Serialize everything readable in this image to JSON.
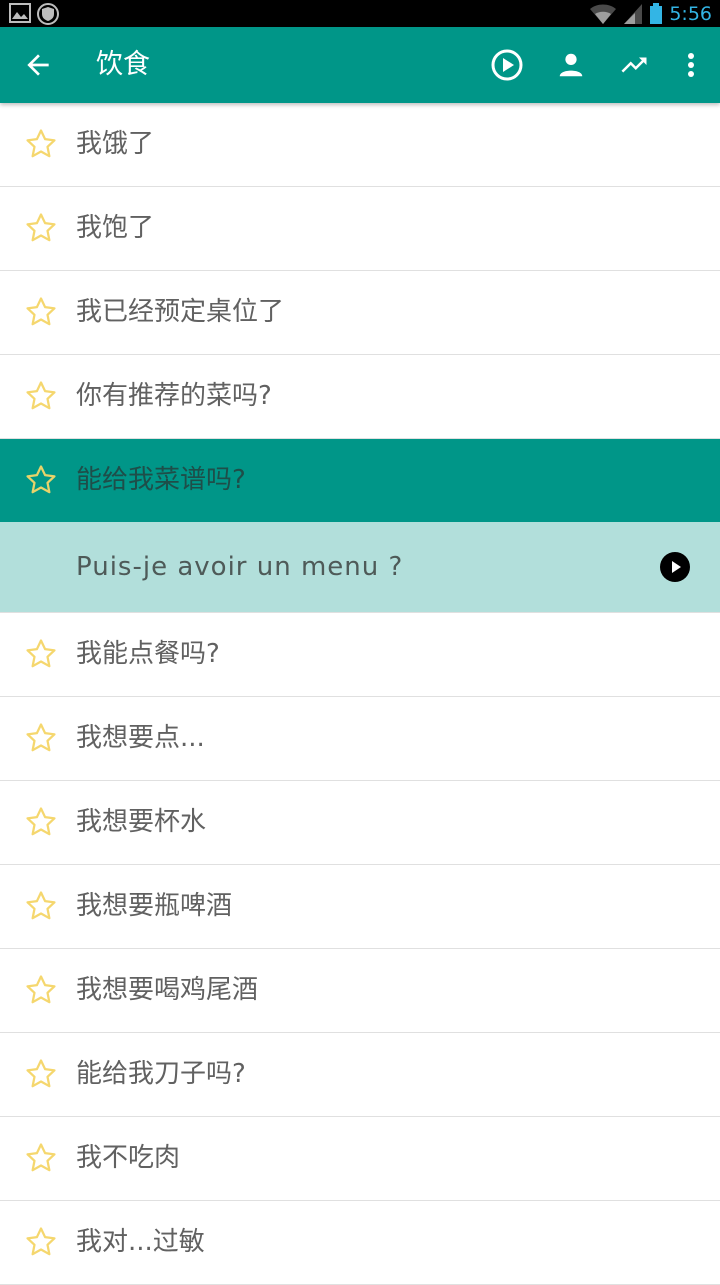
{
  "status_bar": {
    "time": "5:56"
  },
  "toolbar": {
    "title": "饮食",
    "icons": [
      "back-arrow-icon",
      "play-circle-icon",
      "person-icon",
      "trending-up-icon",
      "more-vert-icon"
    ]
  },
  "colors": {
    "primary": "#009688",
    "highlight": "#b2dfdb",
    "star": "#f5d76e",
    "text": "#616161"
  },
  "phrases": [
    {
      "text": "我饿了"
    },
    {
      "text": "我饱了"
    },
    {
      "text": "我已经预定桌位了"
    },
    {
      "text": "你有推荐的菜吗?"
    },
    {
      "text": "能给我菜谱吗?",
      "selected": true
    },
    {
      "text": "我能点餐吗?"
    },
    {
      "text": "我想要点..."
    },
    {
      "text": "我想要杯水"
    },
    {
      "text": "我想要瓶啤酒"
    },
    {
      "text": "我想要喝鸡尾酒"
    },
    {
      "text": "能给我刀子吗?"
    },
    {
      "text": "我不吃肉"
    },
    {
      "text": "我对...过敏"
    }
  ],
  "translation": {
    "text": "Puis-je avoir un menu ?"
  }
}
